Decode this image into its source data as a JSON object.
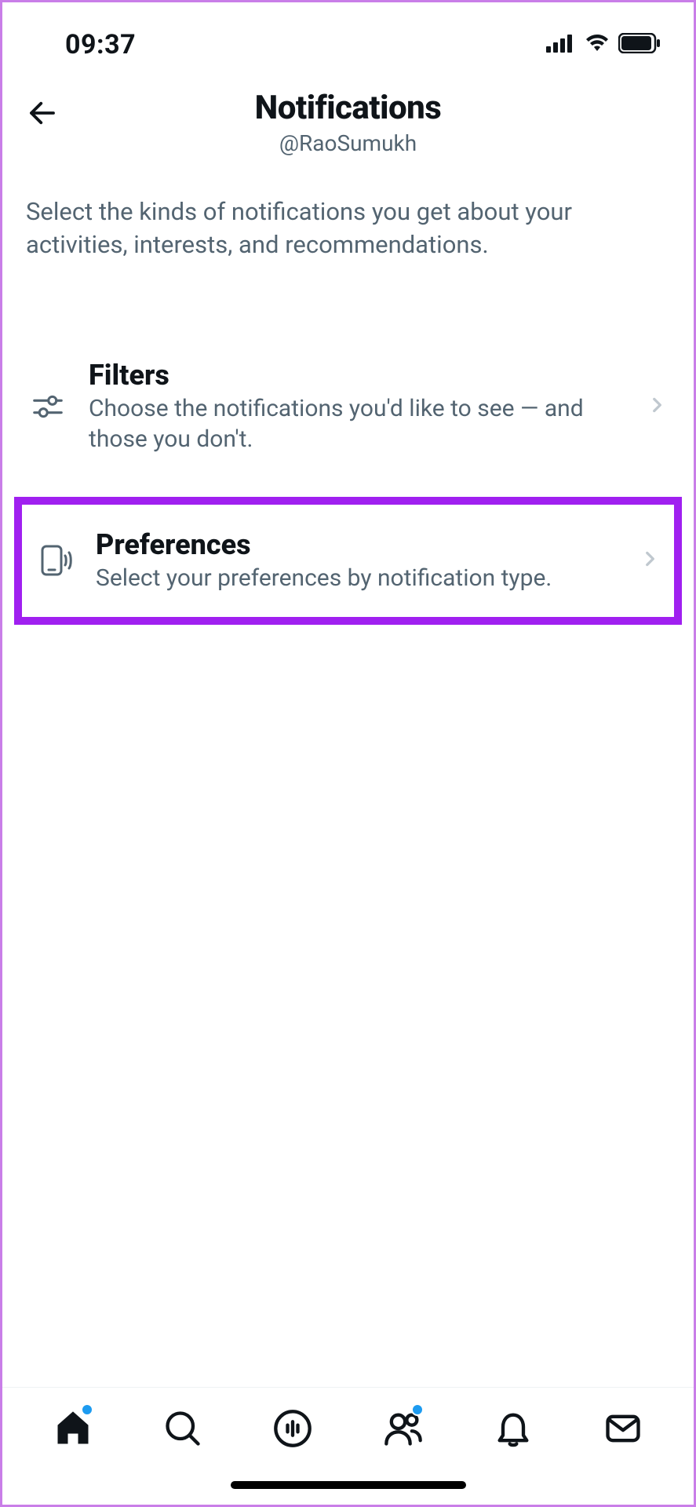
{
  "status": {
    "time": "09:37"
  },
  "header": {
    "title": "Notifications",
    "username": "@RaoSumukh"
  },
  "description": "Select the kinds of notifications you get about your activities, interests, and recommendations.",
  "settings": {
    "filters": {
      "title": "Filters",
      "desc": "Choose the notifications you'd like to see — and those you don't."
    },
    "preferences": {
      "title": "Preferences",
      "desc": "Select your preferences by notification type."
    }
  }
}
